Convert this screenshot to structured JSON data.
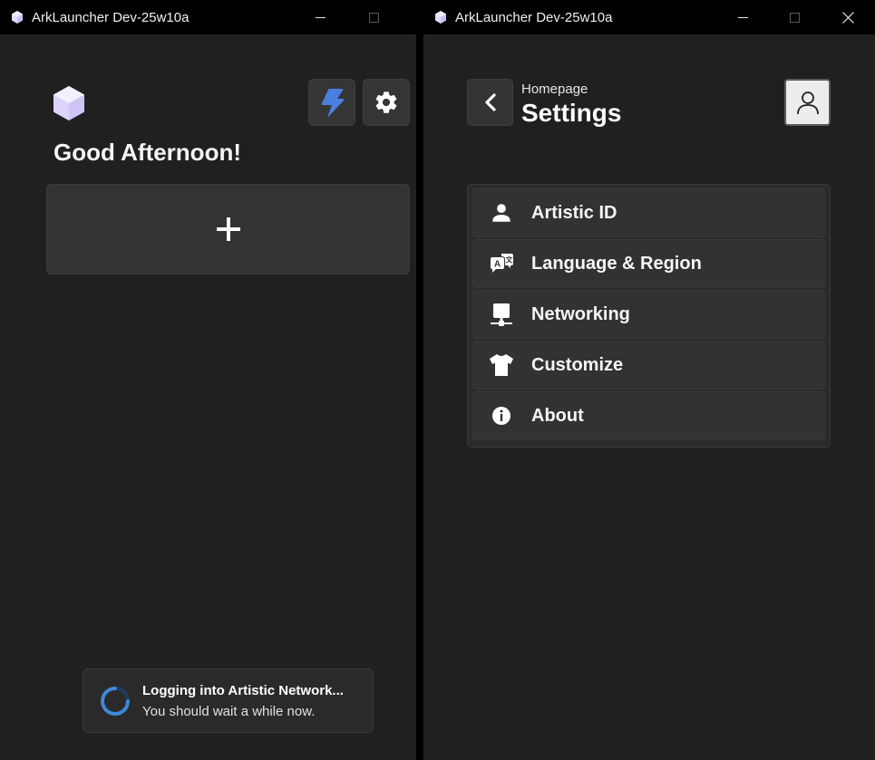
{
  "window_left": {
    "title": "ArkLauncher Dev-25w10a",
    "greeting": "Good Afternoon!",
    "toast": {
      "title": "Logging into Artistic Network...",
      "message": "You should wait a while now."
    }
  },
  "window_right": {
    "title": "ArkLauncher Dev-25w10a",
    "breadcrumb": "Homepage",
    "page_title": "Settings",
    "menu": [
      {
        "label": "Artistic ID",
        "icon": "person-icon"
      },
      {
        "label": "Language & Region",
        "icon": "translate-icon"
      },
      {
        "label": "Networking",
        "icon": "network-icon"
      },
      {
        "label": "Customize",
        "icon": "shirt-icon"
      },
      {
        "label": "About",
        "icon": "info-icon"
      }
    ]
  },
  "colors": {
    "background": "#202020",
    "titlebar": "#000000",
    "accent_blue": "#4a7fe0",
    "logo_purple": "#e4dcff"
  }
}
